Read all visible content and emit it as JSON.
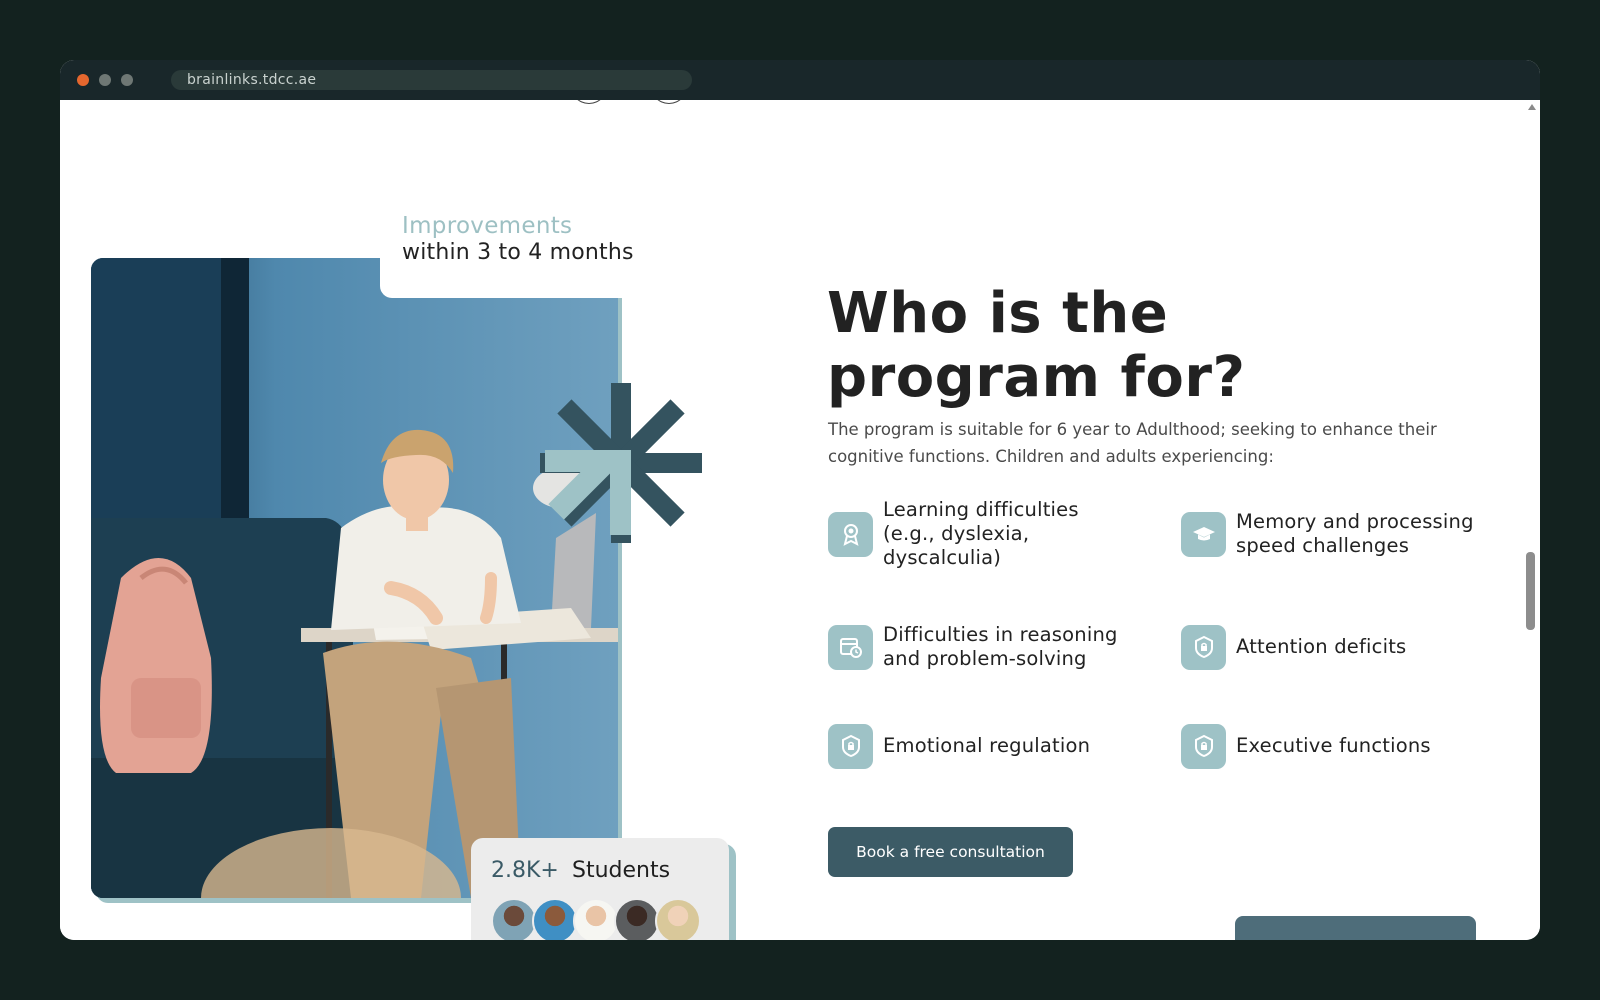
{
  "browser": {
    "url": "brainlinks.tdcc.ae"
  },
  "hero": {
    "improvements_highlight": "Improvements",
    "improvements_sub": "within 3 to 4 months",
    "students_count": "2.8K+",
    "students_label": "Students"
  },
  "section": {
    "heading": "Who is the program for?",
    "intro": "The program is suitable for 6 year to Adulthood; seeking to enhance their cognitive functions. Children and adults experiencing:",
    "features": [
      {
        "label": "Learning difficulties (e.g., dyslexia, dyscalculia)",
        "icon": "award-ribbon-icon"
      },
      {
        "label": "Memory and processing speed challenges",
        "icon": "graduation-cap-icon"
      },
      {
        "label": "Difficulties in reasoning and problem-solving",
        "icon": "calendar-clock-icon"
      },
      {
        "label": "Attention deficits",
        "icon": "shield-lock-icon"
      },
      {
        "label": "Emotional regulation",
        "icon": "shield-lock-icon"
      },
      {
        "label": "Executive functions",
        "icon": "shield-lock-icon"
      }
    ],
    "cta_label": "Book a free consultation"
  },
  "colors": {
    "accent_teal": "#9ec2c6",
    "dark_teal": "#3c5b66",
    "asterisk_dark": "#34535f",
    "page_bg": "#13221f",
    "text_dark": "#222222"
  }
}
